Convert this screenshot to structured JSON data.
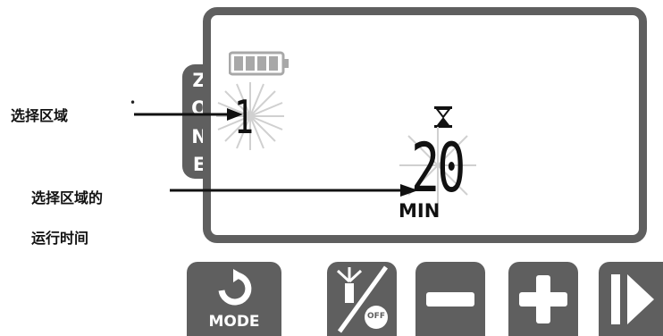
{
  "lcd": {
    "zone_letters": [
      "Z",
      "O",
      "N",
      "E"
    ],
    "zone_number": "1",
    "runtime_value": "20",
    "runtime_unit": "MIN",
    "battery_level": 1.0,
    "icons": [
      "battery-icon",
      "hourglass-icon",
      "sparkle-icon"
    ]
  },
  "callouts": {
    "zone_label": "选择区域",
    "runtime_label_line1": "选择区域的",
    "runtime_label_line2": "运行时间"
  },
  "buttons": {
    "mode_label": "MODE",
    "off_label": "OFF",
    "icons": [
      "refresh-icon",
      "sprinkler-off-icon",
      "minus-icon",
      "plus-icon",
      "next-icon"
    ]
  },
  "colors": {
    "panel": "#5f5f5f",
    "text": "#111111",
    "background": "#ffffff"
  }
}
